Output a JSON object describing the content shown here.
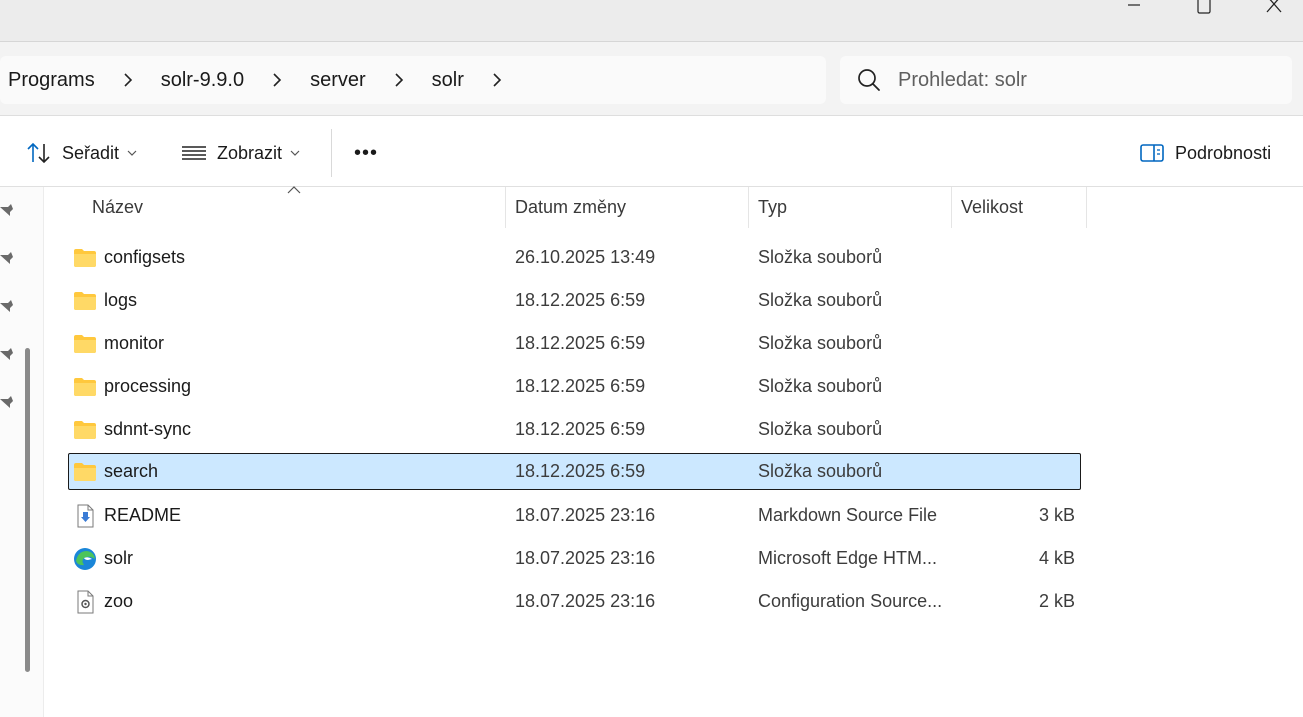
{
  "window": {
    "controls": [
      "minimize-icon",
      "maximize-icon",
      "close-icon"
    ]
  },
  "breadcrumb": {
    "items": [
      "Programs",
      "solr-9.9.0",
      "server",
      "solr"
    ]
  },
  "search": {
    "placeholder": "Prohledat: solr"
  },
  "commands": {
    "sort_label": "Seřadit",
    "view_label": "Zobrazit",
    "more_label": "•••",
    "details_label": "Podrobnosti"
  },
  "columns": {
    "name": "Název",
    "date": "Datum změny",
    "type": "Typ",
    "size": "Velikost"
  },
  "files": [
    {
      "name": "configsets",
      "date": "26.10.2025 13:49",
      "type": "Složka souborů",
      "size": "",
      "icon": "folder-icon",
      "selected": false
    },
    {
      "name": "logs",
      "date": "18.12.2025 6:59",
      "type": "Složka souborů",
      "size": "",
      "icon": "folder-icon",
      "selected": false
    },
    {
      "name": "monitor",
      "date": "18.12.2025 6:59",
      "type": "Složka souborů",
      "size": "",
      "icon": "folder-icon",
      "selected": false
    },
    {
      "name": "processing",
      "date": "18.12.2025 6:59",
      "type": "Složka souborů",
      "size": "",
      "icon": "folder-icon",
      "selected": false
    },
    {
      "name": "sdnnt-sync",
      "date": "18.12.2025 6:59",
      "type": "Složka souborů",
      "size": "",
      "icon": "folder-icon",
      "selected": false
    },
    {
      "name": "search",
      "date": "18.12.2025 6:59",
      "type": "Složka souborů",
      "size": "",
      "icon": "folder-icon",
      "selected": true
    },
    {
      "name": "README",
      "date": "18.07.2025 23:16",
      "type": "Markdown Source File",
      "size": "3 kB",
      "icon": "markdown-file-icon",
      "selected": false
    },
    {
      "name": "solr",
      "date": "18.07.2025 23:16",
      "type": "Microsoft Edge HTM...",
      "size": "4 kB",
      "icon": "edge-html-file-icon",
      "selected": false
    },
    {
      "name": "zoo",
      "date": "18.07.2025 23:16",
      "type": "Configuration Source...",
      "size": "2 kB",
      "icon": "config-file-icon",
      "selected": false
    }
  ],
  "colors": {
    "selection_bg": "#cce8ff",
    "folder_yellow": "#ffc83d",
    "accent_blue": "#0067c0"
  }
}
